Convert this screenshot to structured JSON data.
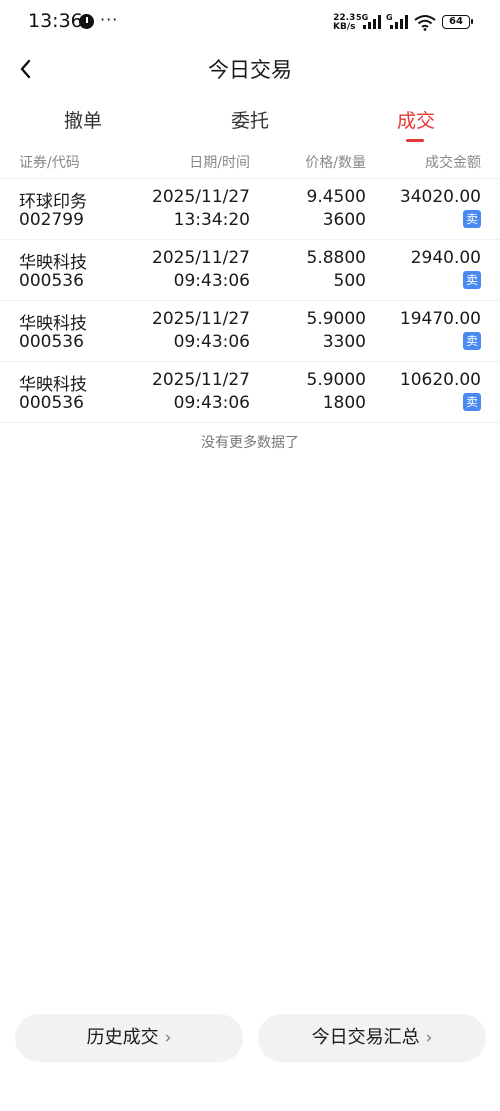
{
  "status_bar": {
    "time": "13:36",
    "dots": "···",
    "speed_value": "22.3",
    "speed_unit": "KB/s",
    "sim1_label": "5G",
    "sim2_label": "G",
    "battery": "64"
  },
  "nav": {
    "title": "今日交易"
  },
  "tabs": [
    {
      "label": "撤单",
      "active": false
    },
    {
      "label": "委托",
      "active": false
    },
    {
      "label": "成交",
      "active": true
    }
  ],
  "table": {
    "headers": {
      "name": "证券/代码",
      "date": "日期/时间",
      "price": "价格/数量",
      "amount": "成交金额"
    },
    "rows": [
      {
        "name": "环球印务",
        "code": "002799",
        "date": "2025/11/27",
        "time": "13:34:20",
        "price": "9.4500",
        "qty": "3600",
        "amount": "34020.00",
        "side": "卖"
      },
      {
        "name": "华映科技",
        "code": "000536",
        "date": "2025/11/27",
        "time": "09:43:06",
        "price": "5.8800",
        "qty": "500",
        "amount": "2940.00",
        "side": "卖"
      },
      {
        "name": "华映科技",
        "code": "000536",
        "date": "2025/11/27",
        "time": "09:43:06",
        "price": "5.9000",
        "qty": "3300",
        "amount": "19470.00",
        "side": "卖"
      },
      {
        "name": "华映科技",
        "code": "000536",
        "date": "2025/11/27",
        "time": "09:43:06",
        "price": "5.9000",
        "qty": "1800",
        "amount": "10620.00",
        "side": "卖"
      }
    ],
    "no_more": "没有更多数据了"
  },
  "buttons": {
    "history": "历史成交",
    "summary": "今日交易汇总",
    "chevron": "›"
  },
  "colors": {
    "accent": "#e53935",
    "sell_badge": "#4a8af0"
  },
  "icons": {
    "back": "back-arrow-icon",
    "wifi": "wifi-icon",
    "battery": "battery-icon"
  }
}
